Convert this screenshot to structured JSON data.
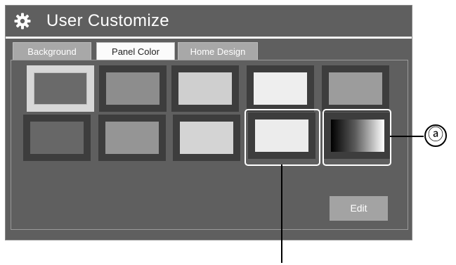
{
  "header": {
    "title": "User Customize",
    "icon": "gear-icon"
  },
  "tabs": [
    {
      "label": "Background",
      "active": false
    },
    {
      "label": "Panel Color",
      "active": true
    },
    {
      "label": "Home Design",
      "active": false
    }
  ],
  "swatches": {
    "row1": [
      {
        "color": "#6a6a6a",
        "selected": true
      },
      {
        "color": "#8d8d8d",
        "selected": false
      },
      {
        "color": "#cfcfcf",
        "selected": false
      },
      {
        "color": "#eeeeee",
        "selected": false
      },
      {
        "color": "#9c9c9c",
        "selected": false
      }
    ],
    "row2": [
      {
        "color": "#676767",
        "selected": false
      },
      {
        "color": "#959595",
        "selected": false
      },
      {
        "color": "#d4d4d4",
        "selected": false
      },
      {
        "color": "#ececec",
        "selected": false
      },
      {
        "color": "gradient-black-to-white",
        "selected": false
      }
    ]
  },
  "edit_button": {
    "label": "Edit"
  },
  "callout": {
    "label": "ⓐ"
  }
}
